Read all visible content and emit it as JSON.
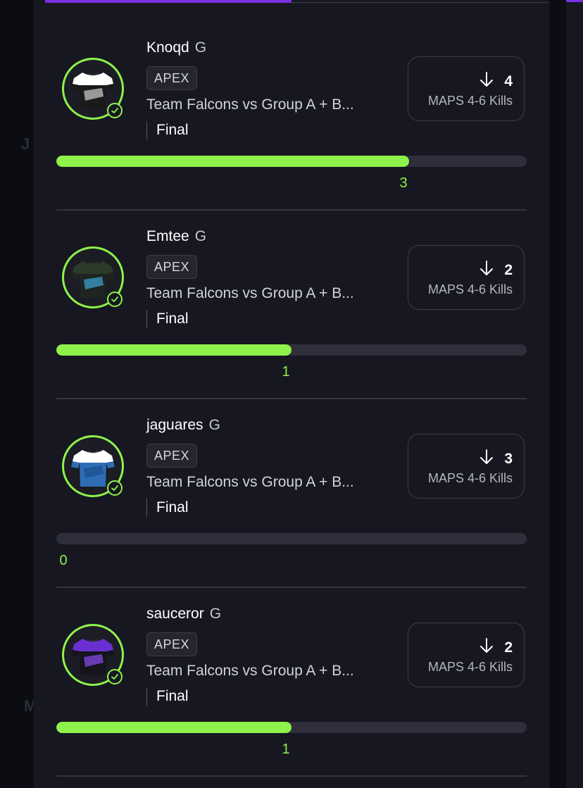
{
  "background": {
    "letters": [
      "J",
      "M"
    ]
  },
  "colors": {
    "accent_green": "#8ef24a",
    "accent_purple": "#7a2fe0",
    "panel": "#161720"
  },
  "cards": [
    {
      "player": "Knoqd",
      "position": "G",
      "game": "APEX",
      "match": "Team Falcons  vs  Group A + B...",
      "status": "Final",
      "direction_icon": "arrow-down-icon",
      "line_value": "4",
      "stat_label": "MAPS 4-6 Kills",
      "actual_value": "3",
      "progress_fraction": 0.75,
      "jersey": {
        "body": "#1a1a1a",
        "top": "#ffffff",
        "accent": "#cfcfcf"
      }
    },
    {
      "player": "Emtee",
      "position": "G",
      "game": "APEX",
      "match": "Team Falcons  vs  Group A + B...",
      "status": "Final",
      "direction_icon": "arrow-down-icon",
      "line_value": "2",
      "stat_label": "MAPS 4-6 Kills",
      "actual_value": "1",
      "progress_fraction": 0.5,
      "jersey": {
        "body": "#1e2420",
        "top": "#2c3a2a",
        "accent": "#3aa7d8"
      }
    },
    {
      "player": "jaguares",
      "position": "G",
      "game": "APEX",
      "match": "Team Falcons  vs  Group A + B...",
      "status": "Final",
      "direction_icon": "arrow-down-icon",
      "line_value": "3",
      "stat_label": "MAPS 4-6 Kills",
      "actual_value": "0",
      "progress_fraction": 0.0,
      "jersey": {
        "body": "#2e6db5",
        "top": "#ffffff",
        "accent": "#1a4f8a"
      }
    },
    {
      "player": "sauceror",
      "position": "G",
      "game": "APEX",
      "match": "Team Falcons  vs  Group A + B...",
      "status": "Final",
      "direction_icon": "arrow-down-icon",
      "line_value": "2",
      "stat_label": "MAPS 4-6 Kills",
      "actual_value": "1",
      "progress_fraction": 0.5,
      "jersey": {
        "body": "#15131c",
        "top": "#6a2fd0",
        "accent": "#8c4df0"
      }
    }
  ]
}
